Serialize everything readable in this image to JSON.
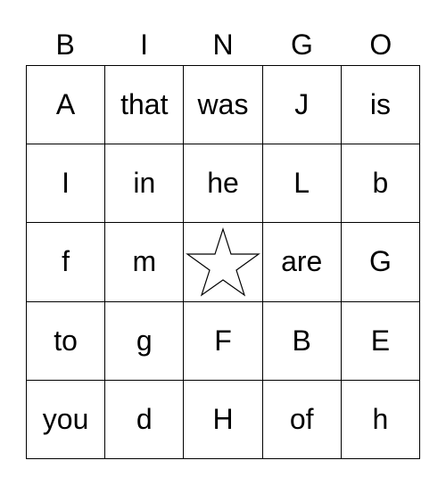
{
  "header": [
    "B",
    "I",
    "N",
    "G",
    "O"
  ],
  "cells": [
    [
      "A",
      "that",
      "was",
      "J",
      "is"
    ],
    [
      "I",
      "in",
      "he",
      "L",
      "b"
    ],
    [
      "f",
      "m",
      "",
      "are",
      "G"
    ],
    [
      "to",
      "g",
      "F",
      "B",
      "E"
    ],
    [
      "you",
      "d",
      "H",
      "of",
      "h"
    ]
  ],
  "free_space_icon": "star-icon"
}
